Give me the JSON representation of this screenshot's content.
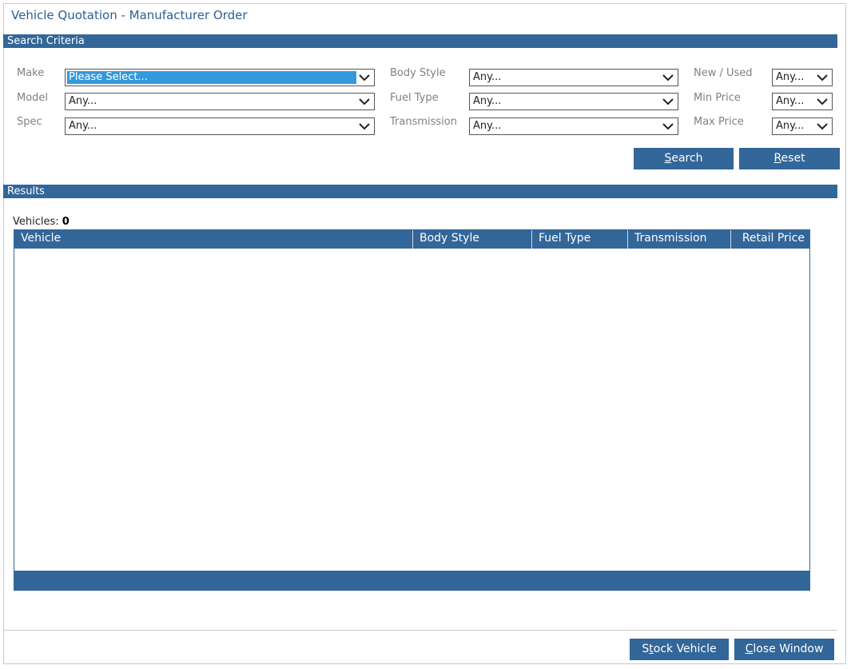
{
  "window": {
    "title": "Vehicle Quotation - Manufacturer Order"
  },
  "search_criteria": {
    "header": "Search Criteria",
    "fields": {
      "make": {
        "label": "Make",
        "value": "Please Select..."
      },
      "model": {
        "label": "Model",
        "value": "Any..."
      },
      "spec": {
        "label": "Spec",
        "value": "Any..."
      },
      "body_style": {
        "label": "Body Style",
        "value": "Any..."
      },
      "fuel_type": {
        "label": "Fuel Type",
        "value": "Any..."
      },
      "transmission": {
        "label": "Transmission",
        "value": "Any..."
      },
      "new_used": {
        "label": "New / Used",
        "value": "Any..."
      },
      "min_price": {
        "label": "Min Price",
        "value": "Any..."
      },
      "max_price": {
        "label": "Max Price",
        "value": "Any..."
      }
    },
    "search_button": {
      "mnemonic": "S",
      "rest": "earch"
    },
    "reset_button": {
      "mnemonic": "R",
      "rest": "eset"
    }
  },
  "results": {
    "header": "Results",
    "count_label": "Vehicles:",
    "count": "0",
    "columns": [
      "Vehicle",
      "Body Style",
      "Fuel Type",
      "Transmission",
      "Retail Price"
    ]
  },
  "footer": {
    "stock_vehicle_button": {
      "pre": "S",
      "mnemonic": "t",
      "rest": "ock Vehicle"
    },
    "close_window_button": {
      "mnemonic": "C",
      "rest": "lose Window"
    }
  },
  "colors": {
    "accent": "#336699",
    "title": "#2c5f93",
    "highlight": "#3399dd",
    "label": "#808080"
  },
  "icons": {
    "dropdown": "chevron-down-icon"
  }
}
